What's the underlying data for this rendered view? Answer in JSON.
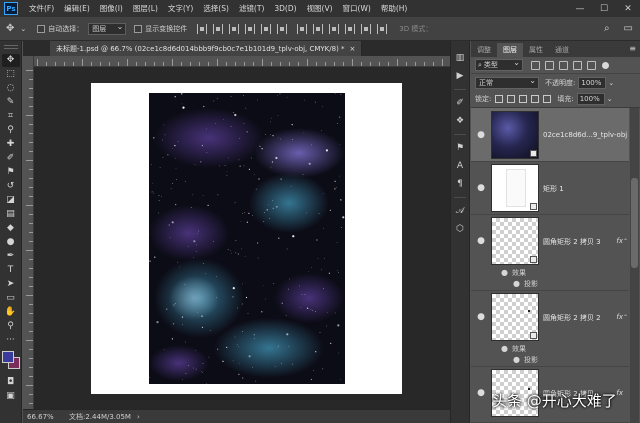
{
  "app": {
    "logo": "Ps"
  },
  "menu": [
    "文件(F)",
    "编辑(E)",
    "图像(I)",
    "图层(L)",
    "文字(Y)",
    "选择(S)",
    "滤镜(T)",
    "3D(D)",
    "视图(V)",
    "窗口(W)",
    "帮助(H)"
  ],
  "window_controls": {
    "minimize": "—",
    "maximize": "☐",
    "close": "✕"
  },
  "options_bar": {
    "move_icon": "move-icon",
    "auto_select_label": "自动选择：",
    "auto_select_value": "图层",
    "transform_label": "显示变换控件",
    "mode_3d_label": "3D 模式："
  },
  "document": {
    "tab_title": "未标题-1.psd @ 66.7% (02ce1c8d6d014bbb9f9cb0c7e1b101d9_tplv-obj, CMYK/8) *",
    "tab_close": "×"
  },
  "status": {
    "zoom": "66.67%",
    "doc_info": "文档:2.44M/3.05M",
    "arrow": "›"
  },
  "panel": {
    "tabs": [
      "调整",
      "图层",
      "属性",
      "通道"
    ],
    "active_tab": 1,
    "menu_icon": "≡",
    "kind_label": "类型",
    "blend_mode": "正常",
    "opacity_label": "不透明度:",
    "opacity_value": "100%",
    "lock_label": "锁定:",
    "fill_label": "填充:",
    "fill_value": "100%"
  },
  "layers": [
    {
      "name": "02ce1c8d6d...9_tplv-obj",
      "type": "smart-object",
      "selected": true,
      "fx": false
    },
    {
      "name": "矩形 1",
      "type": "shape",
      "selected": false,
      "fx": false
    },
    {
      "name": "圆角矩形 2 拷贝 3",
      "type": "shape",
      "selected": false,
      "fx": true,
      "effects": [
        "效果",
        "投影"
      ]
    },
    {
      "name": "圆角矩形 2 拷贝 2",
      "type": "shape",
      "selected": false,
      "fx": true,
      "effects": [
        "效果",
        "投影"
      ]
    },
    {
      "name": "圆角矩形 2 拷贝",
      "type": "shape",
      "selected": false,
      "fx": true
    }
  ],
  "fx_label": "fx",
  "eye_glyph": "●",
  "watermark": "头条 @开心大难了",
  "colors": {
    "foreground": "#3b3b9e",
    "background": "#7a2e5a",
    "accent": "#31a8ff"
  }
}
